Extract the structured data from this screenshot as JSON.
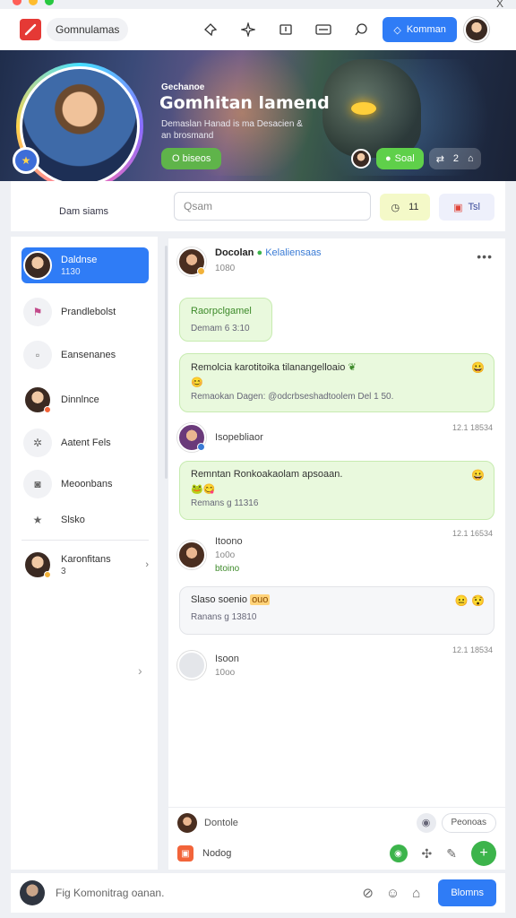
{
  "window": {
    "traffic_colors": [
      "#ff5f57",
      "#febc2e",
      "#28c840"
    ],
    "close_glyph": "X"
  },
  "topbar": {
    "app_name": "Gomnulamas",
    "icons": [
      "pin-icon",
      "sparkle-icon",
      "inbox-icon",
      "screen-icon",
      "chat-bubble-icon"
    ],
    "action_button_label": "Komman",
    "accent_color": "#2f7cf6"
  },
  "banner": {
    "small_label": "Gechanoe",
    "title": "Gomhitan lamend",
    "subtitle": "Demaslan Hanad is ma Desacien & an brosmand",
    "green_button_label": "O biseos",
    "right_green_label": "Soal",
    "right_counts": "2"
  },
  "profile": {
    "name": "Dam siams"
  },
  "search": {
    "placeholder": "Qsam"
  },
  "pills": {
    "yellow_value": "11",
    "red_value": "Tsl"
  },
  "sidebar": {
    "items": [
      {
        "label": "Daldnse",
        "sub": "1130",
        "icon": "avatar"
      },
      {
        "label": "Prandlebolst",
        "icon": "flag-icon"
      },
      {
        "label": "Eansenanes",
        "icon": "square-icon"
      },
      {
        "label": "Dinnlnce",
        "icon": "avatar"
      },
      {
        "label": "Aatent Fels",
        "icon": "gear-icon"
      },
      {
        "label": "Meoonbans",
        "icon": "camera-icon"
      },
      {
        "label": "Slsko",
        "icon": "star-icon"
      },
      {
        "label": "Karonfitans",
        "sub": "3",
        "icon": "avatar"
      }
    ]
  },
  "chat": {
    "header": {
      "name": "Docolan",
      "status": "Kelaliensaas",
      "sub": "1080"
    },
    "messages": [
      {
        "title": "Raorpclgamel",
        "meta": "Demam 6 3:10"
      },
      {
        "title": "Remolcia karotitoika tilanangelloaio",
        "meta": "Remaokan Dagen: @odcrbseshadtoolem Del 1 50."
      },
      {
        "title": "Remntan Ronkoakaolam apsoaan.",
        "meta": "Remans g 11316"
      },
      {
        "title": "Slaso soenio",
        "highlight": "ouo",
        "meta": "Ranans g 13810"
      }
    ],
    "rows": [
      {
        "name": "Isopebliaor",
        "stamp": "12.1 18534"
      },
      {
        "name": "Itoono",
        "sub": "1o0o",
        "extra": "btoino",
        "stamp": "12.1 16534"
      },
      {
        "name": "Isoon",
        "sub": "10oo",
        "stamp": "12.1 18534"
      }
    ],
    "footer": {
      "left_label": "Dontole",
      "ghost_label": "Peonoas",
      "second_label": "Nodog"
    }
  },
  "composer": {
    "placeholder": "Fig Komonitrag oanan.",
    "send_label": "Blomns"
  }
}
